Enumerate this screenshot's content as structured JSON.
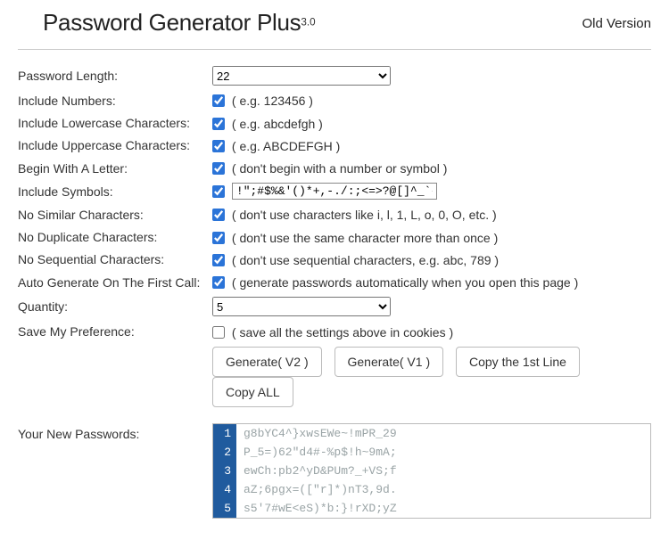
{
  "header": {
    "title": "Password Generator Plus",
    "version_sup": "3.0",
    "old_version": "Old Version"
  },
  "labels": {
    "password_length": "Password Length:",
    "include_numbers": "Include Numbers:",
    "include_lowercase": "Include Lowercase Characters:",
    "include_uppercase": "Include Uppercase Characters:",
    "begin_letter": "Begin With A Letter:",
    "include_symbols": "Include Symbols:",
    "no_similar": "No Similar Characters:",
    "no_duplicate": "No Duplicate Characters:",
    "no_sequential": "No Sequential Characters:",
    "auto_generate": "Auto Generate On The First Call:",
    "quantity": "Quantity:",
    "save_pref": "Save My Preference:",
    "your_passwords": "Your New Passwords:"
  },
  "values": {
    "password_length": "22",
    "quantity": "5",
    "symbols": "!\";#$%&'()*+,-./:;<=>?@[]^_`{|}~"
  },
  "hints": {
    "numbers": "( e.g. 123456 )",
    "lowercase": "( e.g. abcdefgh )",
    "uppercase": "( e.g. ABCDEFGH )",
    "begin_letter": "( don't begin with a number or symbol )",
    "no_similar": "( don't use characters like i, l, 1, L, o, 0, O, etc. )",
    "no_duplicate": "( don't use the same character more than once )",
    "no_sequential": "( don't use sequential characters, e.g. abc, 789 )",
    "auto_generate": "( generate passwords automatically when you open this page )",
    "save_pref": "( save all the settings above in cookies )"
  },
  "buttons": {
    "gen_v2": "Generate( V2 )",
    "gen_v1": "Generate( V1 )",
    "copy_first": "Copy the 1st Line",
    "copy_all": "Copy ALL"
  },
  "passwords": [
    "g8bYC4^}xwsEWe~!mPR_29",
    "P_5=)62\"d4#-%p$!h~9mA;",
    "ewCh:pb2^yD&PUm?_+VS;f",
    "aZ;6pgx=([\"r]*)nT3,9d.",
    "s5'7#wE<eS)*b:}!rXD;yZ"
  ]
}
